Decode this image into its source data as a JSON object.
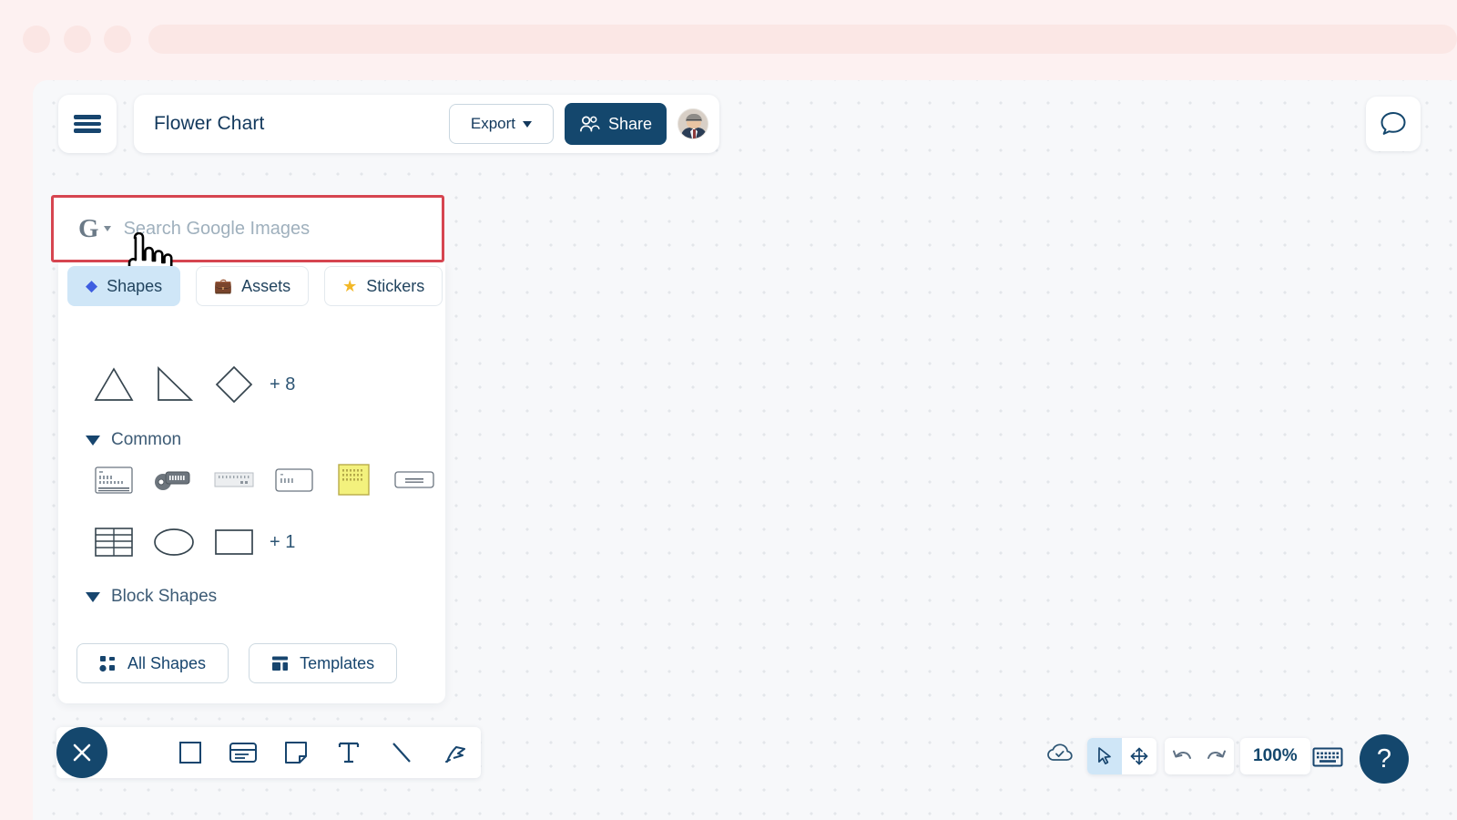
{
  "browser": {
    "dot_1": "traffic-light-red",
    "dot_2": "traffic-light-yellow",
    "dot_3": "traffic-light-green",
    "urlbar_value": ""
  },
  "header": {
    "menu_icon": "hamburger-menu-icon",
    "doc_title": "Flower Chart",
    "export_label": "Export",
    "export_caret": "chevron-down-icon",
    "share_label": "Share",
    "share_icon": "people-icon",
    "share_bg": "#14476d",
    "avatar_alt": "user-avatar",
    "chat_icon": "chat-bubble-icon"
  },
  "search": {
    "provider_icon": "google-g-icon",
    "provider_caret": "chevron-down-icon",
    "placeholder": "Search Google Images",
    "value": "",
    "highlight_color": "#d64550"
  },
  "cursor": {
    "type": "pointing-hand-cursor"
  },
  "panel": {
    "tabs": [
      {
        "label": "Shapes",
        "icon": "blue-diamond-icon",
        "active": true
      },
      {
        "label": "Assets",
        "icon": "briefcase-icon",
        "active": false
      },
      {
        "label": "Stickers",
        "icon": "yellow-star-icon",
        "active": false
      }
    ],
    "basic_shapes": [
      {
        "name": "triangle-shape"
      },
      {
        "name": "right-triangle-shape"
      },
      {
        "name": "diamond-shape"
      }
    ],
    "basic_more": "+ 8",
    "sections": [
      {
        "title": "Common",
        "expanded": true
      },
      {
        "title": "Block Shapes",
        "expanded": true
      }
    ],
    "common_row_1": [
      {
        "name": "card-thumbnail"
      },
      {
        "name": "tag-label-thumbnail"
      },
      {
        "name": "ruler-strip-thumbnail"
      },
      {
        "name": "small-card-thumbnail"
      },
      {
        "name": "sticky-note-thumbnail"
      },
      {
        "name": "banner-thumbnail"
      }
    ],
    "common_row_2": [
      {
        "name": "table-shape"
      },
      {
        "name": "ellipse-shape"
      },
      {
        "name": "rectangle-shape"
      }
    ],
    "common_more": "+ 1",
    "actions": [
      {
        "label": "All Shapes",
        "icon": "grid-dots-icon"
      },
      {
        "label": "Templates",
        "icon": "layout-icon"
      }
    ]
  },
  "bottom_toolbar": {
    "close_icon": "close-x-icon",
    "tools": [
      {
        "name": "square-tool-icon"
      },
      {
        "name": "card-tool-icon"
      },
      {
        "name": "note-tool-icon"
      },
      {
        "name": "text-tool-icon"
      },
      {
        "name": "line-tool-icon"
      },
      {
        "name": "pen-draw-tool-icon"
      }
    ]
  },
  "status_bar": {
    "cloud_icon": "cloud-saved-icon",
    "modes": [
      {
        "name": "select-cursor-icon",
        "active": true
      },
      {
        "name": "pan-move-icon",
        "active": false
      }
    ],
    "history": [
      {
        "name": "undo-icon"
      },
      {
        "name": "redo-icon"
      }
    ],
    "zoom_level": "100%",
    "keyboard_icon": "keyboard-icon",
    "help_label": "?"
  }
}
